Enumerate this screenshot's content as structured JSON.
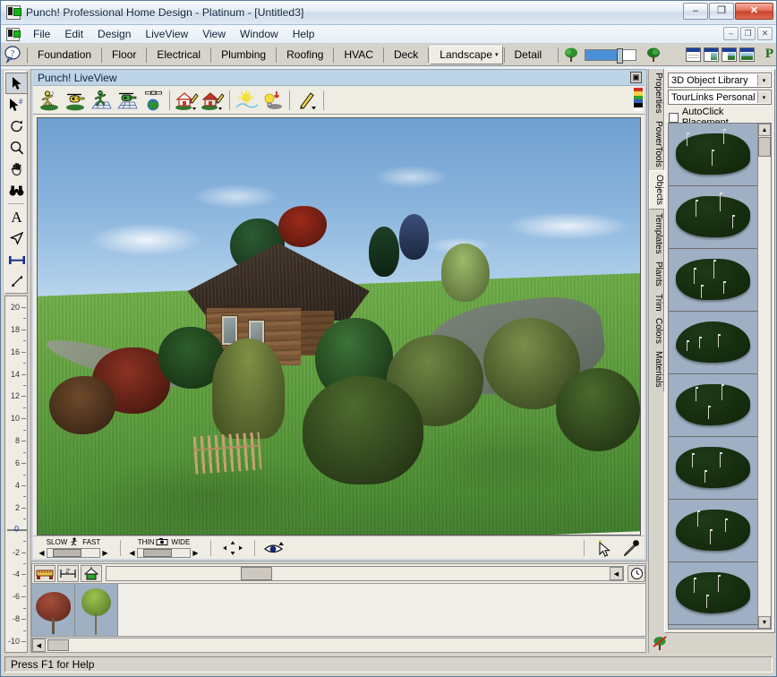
{
  "window": {
    "title": "Punch! Professional Home Design - Platinum - [Untitled3]",
    "app_icon": "punch-app-icon",
    "minimize_label": "–",
    "maximize_label": "❐",
    "close_label": "✕"
  },
  "menubar": {
    "doc_icon": "document-icon",
    "items": [
      {
        "label": "File"
      },
      {
        "label": "Edit"
      },
      {
        "label": "Design"
      },
      {
        "label": "LiveView"
      },
      {
        "label": "View"
      },
      {
        "label": "Window"
      },
      {
        "label": "Help"
      }
    ],
    "mdi": {
      "minimize": "–",
      "restore": "❐",
      "close": "✕"
    }
  },
  "tabstrip": {
    "help_icon": "help-question-icon",
    "tabs": [
      {
        "label": "Foundation",
        "active": false
      },
      {
        "label": "Floor",
        "active": false
      },
      {
        "label": "Electrical",
        "active": false
      },
      {
        "label": "Plumbing",
        "active": false
      },
      {
        "label": "Roofing",
        "active": false
      },
      {
        "label": "HVAC",
        "active": false
      },
      {
        "label": "Deck",
        "active": false
      },
      {
        "label": "Landscape",
        "active": true,
        "caret": "▾"
      },
      {
        "label": "Detail",
        "active": false
      }
    ],
    "plant_icon": "tree-icon",
    "view_buttons": [
      "plan-view-icon",
      "split-view-icon",
      "elevation-view-icon",
      "render-view-icon"
    ],
    "brand": "P"
  },
  "left_toolbar": {
    "tools": [
      {
        "name": "select-arrow-tool",
        "glyph": "↖",
        "selected": true
      },
      {
        "name": "select-grid-tool",
        "glyph": "↖"
      },
      {
        "name": "rotate-tool",
        "glyph": "↻"
      },
      {
        "name": "zoom-tool",
        "glyph": "⚲"
      },
      {
        "name": "pan-hand-tool",
        "glyph": "✋"
      },
      {
        "name": "binoculars-tool",
        "glyph": "⋈"
      },
      {
        "name": "text-tool",
        "glyph": "A"
      },
      {
        "name": "pointer-flag-tool",
        "glyph": "➤"
      },
      {
        "name": "dimension-tool",
        "glyph": "↔"
      },
      {
        "name": "measure-tool",
        "glyph": "⤡"
      }
    ],
    "ruler_labels": [
      "20",
      "18",
      "16",
      "14",
      "12",
      "10",
      "8",
      "6",
      "4",
      "2",
      "0",
      "-2",
      "-4",
      "-6",
      "-8",
      "-10"
    ],
    "ruler_zero": "0"
  },
  "liveview": {
    "title": "Punch! LiveView",
    "close_label": "▣",
    "toolbar": [
      {
        "name": "walkthrough-icon"
      },
      {
        "name": "flyover-icon"
      },
      {
        "name": "walk-on-grid-icon"
      },
      {
        "name": "fly-on-grid-icon"
      },
      {
        "name": "satellite-view-icon"
      },
      {
        "name": "edit-exterior-icon"
      },
      {
        "name": "edit-interior-icon"
      },
      {
        "name": "sunlight-icon"
      },
      {
        "name": "artificial-light-icon"
      },
      {
        "name": "pencil-edit-icon"
      }
    ],
    "palette_icon": "color-palette-strip",
    "controls": {
      "speed": {
        "min_label": "SLOW",
        "max_label": "FAST",
        "icon": "runner-icon",
        "left_arrow": "◀",
        "right_arrow": "▶"
      },
      "width": {
        "min_label": "THIN",
        "max_label": "WIDE",
        "icon": "camera-icon",
        "left_arrow": "◀",
        "right_arrow": "▶"
      },
      "pan_pad_icon": "four-way-pan-icon",
      "eye_icon": "eye-view-icon",
      "cursor_icon": "arrow-cursor-icon",
      "eyedropper_icon": "eyedropper-icon"
    }
  },
  "bottom_panel": {
    "buttons": [
      {
        "name": "ruler-measure-button",
        "glyph": "┅"
      },
      {
        "name": "dimension-2ft-button",
        "glyph": "2'"
      },
      {
        "name": "home-elevation-button",
        "glyph": "⌂"
      }
    ],
    "clock_icon": "clock-icon",
    "scroll_left": "◀",
    "scroll_right": "▶",
    "thumbnails": [
      {
        "name": "plant-thumbnail-red-tree"
      },
      {
        "name": "plant-thumbnail-green-tree"
      }
    ]
  },
  "right_panel": {
    "vtabs": [
      {
        "label": "Properties",
        "active": false
      },
      {
        "label": "PowerTools",
        "active": false
      },
      {
        "label": "Objects",
        "active": true
      },
      {
        "label": "Templates",
        "active": false
      },
      {
        "label": "Plants",
        "active": false
      },
      {
        "label": "Trim",
        "active": false
      },
      {
        "label": "Colors",
        "active": false
      },
      {
        "label": "Materials",
        "active": false
      }
    ],
    "library_select": {
      "value": "3D Object Library",
      "caret": "▾"
    },
    "category_select": {
      "value": "TourLinks Personal ...",
      "caret": "▾"
    },
    "autoclick": {
      "label": "AutoClick Placement",
      "checked": false
    },
    "objects": [
      {
        "name": "golf-green-object-1"
      },
      {
        "name": "golf-green-object-2"
      },
      {
        "name": "golf-green-object-3"
      },
      {
        "name": "golf-green-object-4"
      },
      {
        "name": "golf-green-object-5"
      },
      {
        "name": "golf-green-object-6"
      },
      {
        "name": "golf-green-object-7"
      },
      {
        "name": "golf-green-object-8"
      }
    ],
    "scroll_up": "▲",
    "scroll_down": "▼",
    "delete_plant_icon": "delete-tree-icon"
  },
  "statusbar": {
    "text": "Press F1 for Help"
  },
  "colors": {
    "titlebar_text": "#10233b",
    "tab_active_bg": "#efece4",
    "liveview_title_bg": "#bcd4e6",
    "close_button": "#c9412c",
    "grass": "#63a240",
    "sky": "#8ab4dc",
    "roof": "#3d3027"
  }
}
